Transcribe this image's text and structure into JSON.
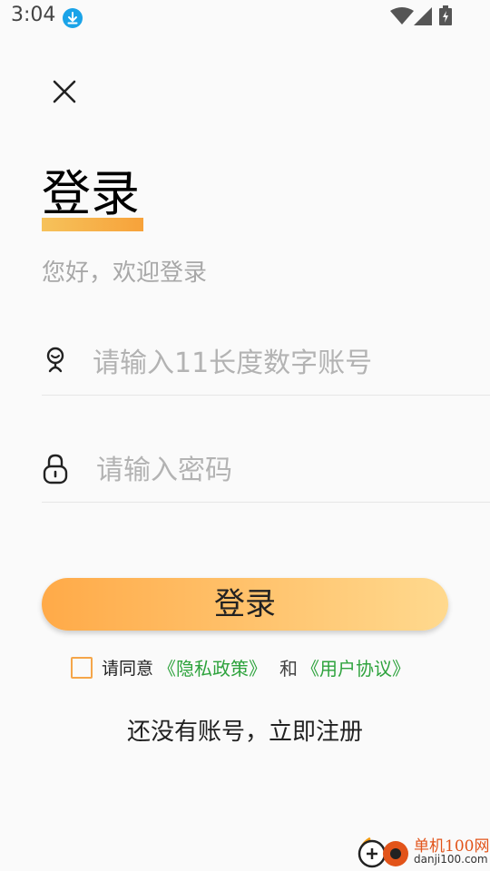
{
  "status_bar": {
    "time": "3:04"
  },
  "header": {
    "title": "登录",
    "subtitle": "您好，欢迎登录"
  },
  "form": {
    "account_placeholder": "请输入11长度数字账号",
    "account_value": "",
    "password_placeholder": "请输入密码",
    "password_value": "",
    "login_button": "登录"
  },
  "agreement": {
    "prefix": "请同意",
    "privacy_link": "《隐私政策》",
    "and": "和",
    "user_link": "《用户协议》",
    "checked": false
  },
  "register_link": "还没有账号，立即注册",
  "watermark": {
    "name": "单机100网",
    "url": "danji100.com"
  },
  "colors": {
    "accent_start": "#ffaa48",
    "accent_end": "#ffd98e",
    "link_green": "#2ea33d",
    "placeholder": "#b3b3b3"
  }
}
